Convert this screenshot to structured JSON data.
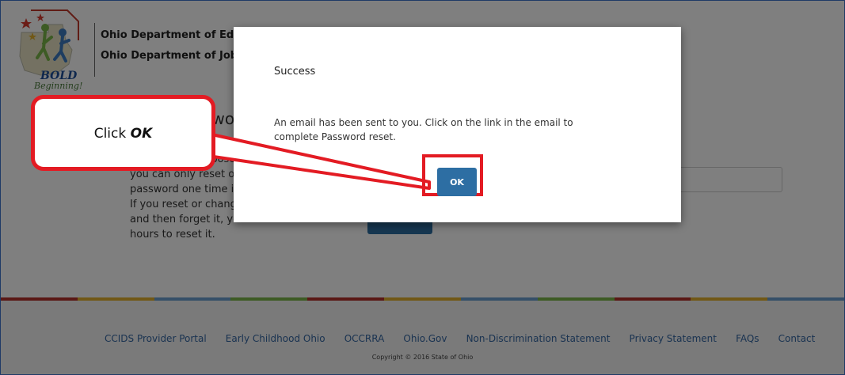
{
  "header": {
    "logo_bold": "BOLD",
    "logo_beginning": "Beginning!",
    "agency_1": "Ohio Department of Education",
    "agency_2": "Ohio Department of Job and Family Services"
  },
  "content": {
    "title": "Reset Password",
    "text": "For security purposes, please note that you can only reset or change your password one time in a 24-hour period. If you reset or change your password and then forget it, you must wait 24-hours to reset it."
  },
  "modal": {
    "title": "Success",
    "message": "An email has been sent to you. Click on the link in the email to complete Password reset.",
    "ok_label": "OK"
  },
  "callout": {
    "prefix": "Click ",
    "emphasis": "OK"
  },
  "footer": {
    "links": [
      "CCIDS Provider Portal",
      "Early Childhood Ohio",
      "OCCRRA",
      "Ohio.Gov",
      "Non-Discrimination Statement",
      "Privacy Statement",
      "FAQs",
      "Contact"
    ],
    "copyright": "Copyright © 2016 State of Ohio"
  },
  "colors": {
    "accent_blue": "#2d6ea3",
    "annotation_red": "#e31b23",
    "footer_bar": [
      "#b5302a",
      "#e3b12d",
      "#6a9ed0",
      "#7ab648",
      "#b5302a",
      "#e3b12d",
      "#6a9ed0",
      "#7ab648",
      "#b5302a",
      "#e3b12d",
      "#6a9ed0"
    ]
  }
}
